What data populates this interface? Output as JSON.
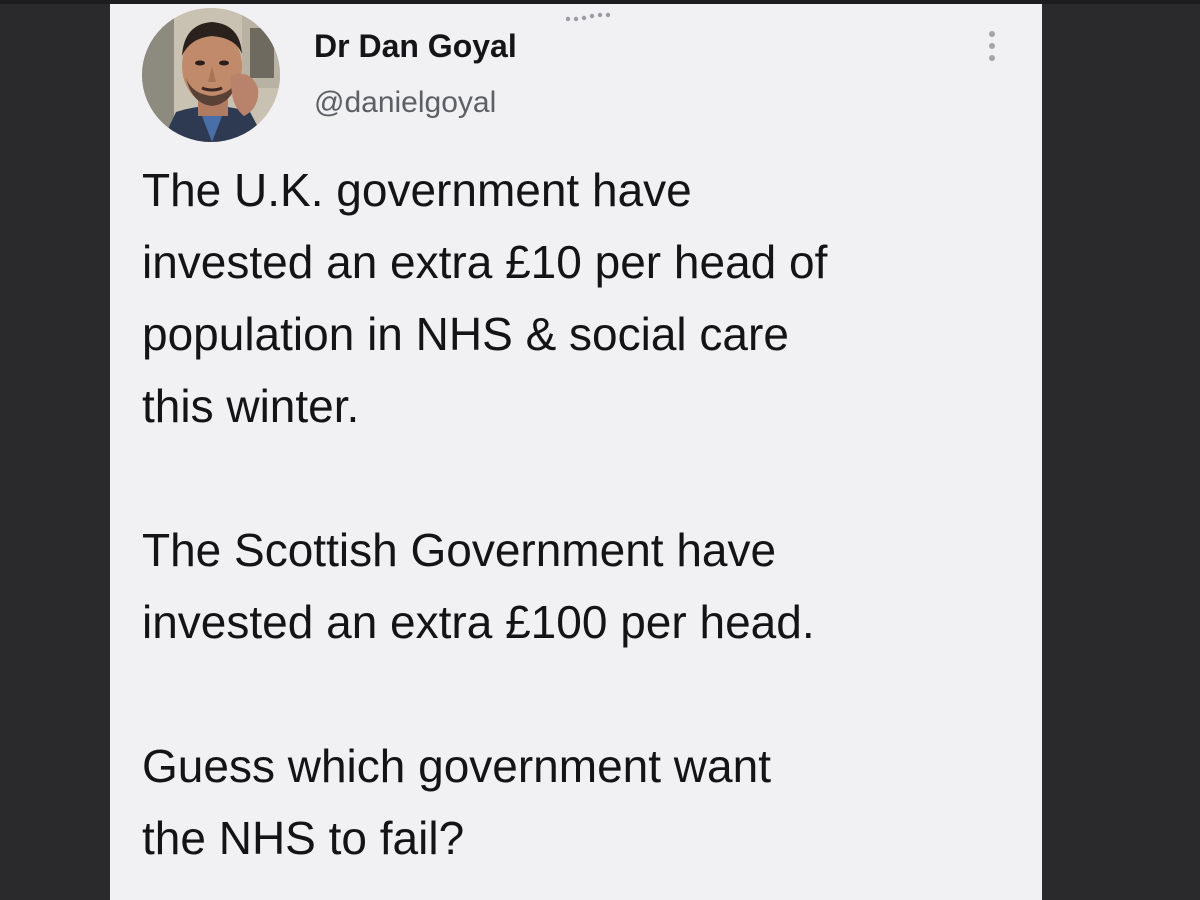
{
  "tweet": {
    "author": {
      "display_name": "Dr Dan Goyal",
      "handle": "@danielgoyal",
      "avatar_icon": "profile-photo"
    },
    "more_icon": "more-options-icon",
    "paragraphs": [
      [
        "The U.K. government have",
        "invested an extra £10 per head of",
        "population in NHS & social care",
        "this winter."
      ],
      [
        "The Scottish Government have",
        "invested an extra £100 per head."
      ],
      [
        "Guess which government want",
        "the NHS to fail?"
      ]
    ]
  },
  "colors": {
    "card_background": "#f1f0f3",
    "text": "#141417",
    "handle_text": "#5c5f66",
    "page_background": "#262628"
  }
}
